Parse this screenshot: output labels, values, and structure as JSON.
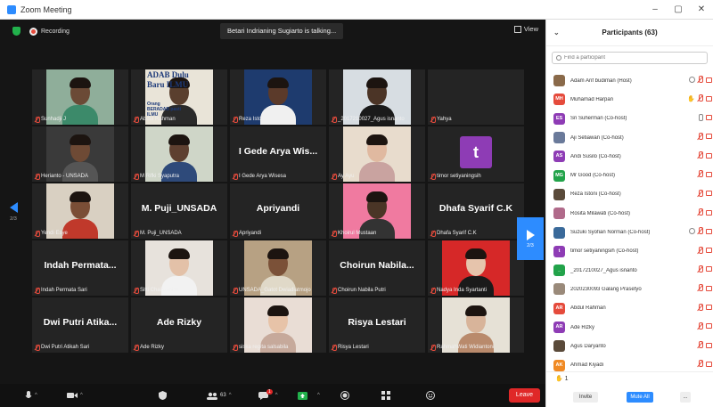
{
  "window": {
    "title": "Zoom Meeting",
    "min": "–",
    "max": "▢",
    "close": "✕"
  },
  "topbar": {
    "recording": "Recording",
    "talking": "Betari Indrianing Sugiarto is talking...",
    "view": "View"
  },
  "nav": {
    "left_page": "2/3",
    "right_page": "2/3"
  },
  "tiles": [
    {
      "name": "Sunhadji J",
      "kind": "video",
      "bg": "#8fae9a",
      "face": "#6b4a36",
      "shirt": "#3c8a6a"
    },
    {
      "name": "Abdul Rahman",
      "kind": "video",
      "bg": "#e9e4d8",
      "face": "#5a3f2e",
      "shirt": "#2a2a2a",
      "overlay_top": "ADAB Dulu",
      "overlay_mid": "Baru ILMU",
      "overlay_bottom": "Orang BERADAB pasti ILMU"
    },
    {
      "name": "Reza Istoni",
      "kind": "video",
      "bg": "#1e3b6e",
      "face": "#5b3a2a",
      "shirt": "#f0f0f0"
    },
    {
      "name": "_2017210027_Agus isnanto",
      "kind": "video",
      "bg": "#d7dde2",
      "face": "#4b3426",
      "shirt": "#1a1a1a"
    },
    {
      "name": "Yahya",
      "kind": "blank"
    },
    {
      "name": "Herianto - UNSADA",
      "kind": "video",
      "bg": "#3a3a3a",
      "face": "#6e4a35",
      "shirt": "#555555"
    },
    {
      "name": "M Rifki Syaputra",
      "kind": "video",
      "bg": "#cfd6c8",
      "face": "#5e4030",
      "shirt": "#2e4a7a"
    },
    {
      "name": "I Gede Arya Wisesa",
      "kind": "bigname",
      "big": "I Gede Arya Wis..."
    },
    {
      "name": "Ay Ayu",
      "kind": "video",
      "bg": "#e8dccd",
      "face": "#e0b9a0",
      "shirt": "#c9a3a0"
    },
    {
      "name": "timor setiyaningsih",
      "kind": "letter",
      "letter": "t",
      "color": "#8e3cb5"
    },
    {
      "name": "Yendi Esye",
      "kind": "video",
      "bg": "#d9d0c2",
      "face": "#7a4e36",
      "shirt": "#c0392b"
    },
    {
      "name": "M. Puji_UNSADA",
      "kind": "bigname",
      "big": "M. Puji_UNSADA"
    },
    {
      "name": "Apriyandi",
      "kind": "bigname",
      "big": "Apriyandi"
    },
    {
      "name": "Khoirul Mustaan",
      "kind": "video",
      "bg": "#f07aa0",
      "face": "#4a3526",
      "shirt": "#333333"
    },
    {
      "name": "Dhafa Syarif C.K",
      "kind": "bigname",
      "big": "Dhafa Syarif C.K"
    },
    {
      "name": "Indah Permata Sari",
      "kind": "bigname",
      "big": "Indah Permata..."
    },
    {
      "name": "Sitti Chairunnisa",
      "kind": "video",
      "bg": "#e7e2dc",
      "face": "#e3c1a8",
      "shirt": "#f2f2f2"
    },
    {
      "name": "UNSADA_Gatot Dwiadiatmojo",
      "kind": "video",
      "bg": "#b7a183",
      "face": "#7b5138",
      "shirt": "#e0d9c8"
    },
    {
      "name": "Choirun Nabila Putri",
      "kind": "bigname",
      "big": "Choirun Nabila..."
    },
    {
      "name": "Nadya Inda Syartanti",
      "kind": "video",
      "bg": "#d62828",
      "face": "#e6c4ac",
      "shirt": "#1a1a1a"
    },
    {
      "name": "Dwi Putri Atikah Sari",
      "kind": "bigname",
      "big": "Dwi Putri Atika..."
    },
    {
      "name": "Ade Rizky",
      "kind": "bigname",
      "big": "Ade Rizky"
    },
    {
      "name": "siska regita salsabila",
      "kind": "video",
      "bg": "#e9ddd5",
      "face": "#e7c3a8",
      "shirt": "#c6a99b"
    },
    {
      "name": "Risya Lestari",
      "kind": "bigname",
      "big": "Risya Lestari"
    },
    {
      "name": "RahmahWati Widiantoni",
      "kind": "video",
      "bg": "#e6e1d6",
      "face": "#d8b49a",
      "shirt": "#b98a6c"
    }
  ],
  "toolbar": {
    "participant_count": "63",
    "chat_badge": "1",
    "leave": "Leave"
  },
  "panel": {
    "title": "Participants (63)",
    "search_placeholder": "Find a participant",
    "participants": [
      {
        "name": "Adam Arif budiman (Host)",
        "initials": "",
        "color": "#8a6a4a",
        "photo": true,
        "share": true,
        "hand": false,
        "mic": "muted",
        "cam": "off"
      },
      {
        "name": "Muhamad Harpan",
        "initials": "MH",
        "color": "#e54b3c",
        "photo": false,
        "share": false,
        "hand": true,
        "mic": "muted",
        "cam": "off"
      },
      {
        "name": "Sri Suherman (Co-host)",
        "initials": "ES",
        "color": "#8e3cb5",
        "photo": false,
        "share": false,
        "hand": false,
        "mic": "on",
        "cam": "off"
      },
      {
        "name": "Aji Setiawan (Co-host)",
        "initials": "",
        "color": "#6a7a9a",
        "photo": true,
        "share": false,
        "hand": false,
        "mic": "muted",
        "cam": "off"
      },
      {
        "name": "Andi Susilo (Co-host)",
        "initials": "AS",
        "color": "#8e3cb5",
        "photo": false,
        "share": false,
        "hand": false,
        "mic": "muted",
        "cam": "off"
      },
      {
        "name": "Mr Good (Co-host)",
        "initials": "MG",
        "color": "#22a34a",
        "photo": false,
        "share": false,
        "hand": false,
        "mic": "muted",
        "cam": "off"
      },
      {
        "name": "Reza Istoni (Co-host)",
        "initials": "",
        "color": "#5a4a3a",
        "photo": true,
        "share": false,
        "hand": false,
        "mic": "muted",
        "cam": "off"
      },
      {
        "name": "Rosita Milawati (Co-host)",
        "initials": "",
        "color": "#b06a8a",
        "photo": true,
        "share": false,
        "hand": false,
        "mic": "muted",
        "cam": "off"
      },
      {
        "name": "Suzuki Syofian Norman (Co-host)",
        "initials": "",
        "color": "#3a6a9a",
        "photo": true,
        "share": true,
        "hand": false,
        "mic": "muted",
        "cam": "off"
      },
      {
        "name": "timor setiyaningsih (Co-host)",
        "initials": "t",
        "color": "#8e3cb5",
        "photo": false,
        "share": false,
        "hand": false,
        "mic": "muted",
        "cam": "off"
      },
      {
        "name": "_2017210027_Agus isnanto",
        "initials": "_",
        "color": "#22a34a",
        "photo": false,
        "share": false,
        "hand": false,
        "mic": "muted",
        "cam": "off"
      },
      {
        "name": "2020230093 Galang Prasetyo",
        "initials": "",
        "color": "#9a8a7a",
        "photo": true,
        "share": false,
        "hand": false,
        "mic": "muted",
        "cam": "off"
      },
      {
        "name": "Abdul Rahman",
        "initials": "AR",
        "color": "#e54b3c",
        "photo": false,
        "share": false,
        "hand": false,
        "mic": "muted",
        "cam": "off"
      },
      {
        "name": "Ade Rizky",
        "initials": "AR",
        "color": "#8e3cb5",
        "photo": false,
        "share": false,
        "hand": false,
        "mic": "muted",
        "cam": "off"
      },
      {
        "name": "Agus Daryanto",
        "initials": "",
        "color": "#5a4a3a",
        "photo": true,
        "share": false,
        "hand": false,
        "mic": "muted",
        "cam": "off"
      },
      {
        "name": "Ahmad Kiyadi",
        "initials": "AK",
        "color": "#f08a24",
        "photo": false,
        "share": false,
        "hand": false,
        "mic": "muted",
        "cam": "off"
      }
    ],
    "raised_count": "1",
    "invite": "Invite",
    "mute_all": "Mute All",
    "more": "..."
  }
}
